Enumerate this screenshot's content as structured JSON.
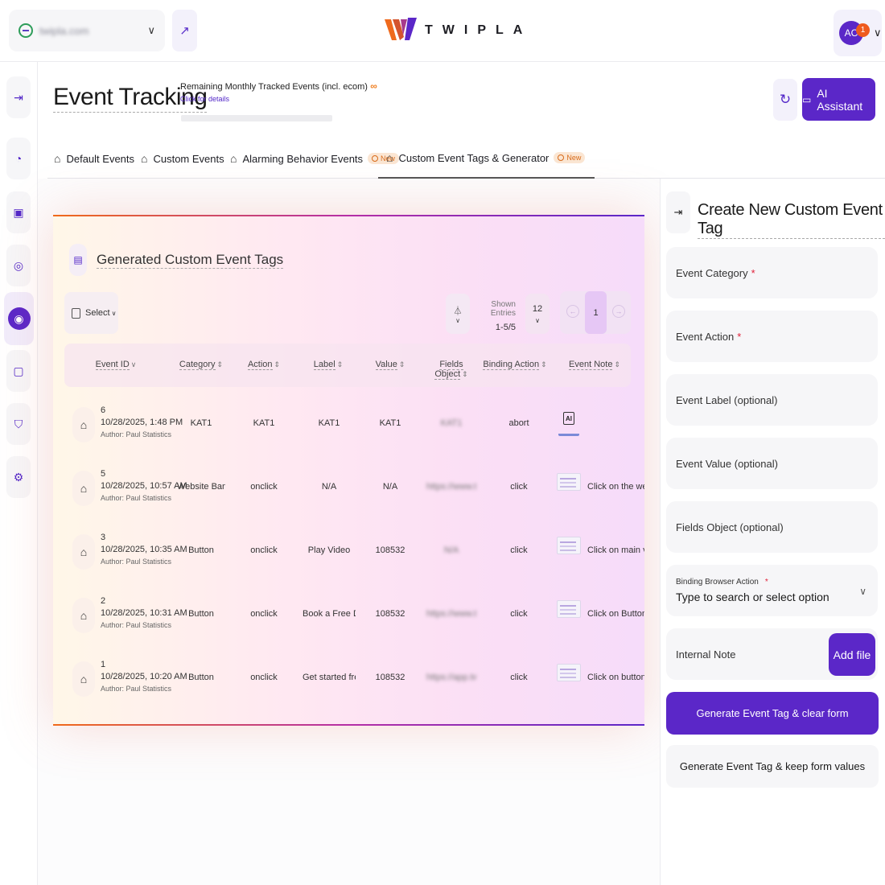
{
  "topbar": {
    "site": "twipla.com",
    "brand": "TWIPLA",
    "user_initials": "AC",
    "notification_count": "1"
  },
  "header": {
    "title": "Event Tracking",
    "quota_label": "Remaining Monthly Tracked Events (incl. ecom)",
    "quota_value": "∞",
    "quota_link": "Click for details",
    "ai_label": "AI Assistant"
  },
  "tabs": [
    {
      "label": "Default Events",
      "badge": ""
    },
    {
      "label": "Custom Events",
      "badge": ""
    },
    {
      "label": "Alarming Behavior Events",
      "badge": "New"
    },
    {
      "label": "Custom Event Tags & Generator",
      "badge": "New",
      "active": true
    }
  ],
  "table": {
    "title": "Generated Custom Event Tags",
    "select_label": "Select",
    "entries_label": "Shown Entries",
    "entries_range": "1-5/5",
    "per_page": "12",
    "page": "1",
    "columns": [
      "Event ID",
      "Category",
      "Action",
      "Label",
      "Value",
      "Fields Object",
      "Binding Action",
      "Event Note"
    ],
    "rows": [
      {
        "id": "6",
        "date": "10/28/2025, 1:48 PM",
        "author": "Author: Paul Statistics",
        "category": "KAT1",
        "action": "KAT1",
        "label": "KAT1",
        "value": "KAT1",
        "fields": "KAT1",
        "binding": "abort",
        "note": "",
        "note_type": "ai"
      },
      {
        "id": "5",
        "date": "10/28/2025, 10:57 AM",
        "author": "Author: Paul Statistics",
        "category": "Website Banner",
        "action": "onclick",
        "label": "N/A",
        "value": "N/A",
        "fields": "https://www.tw...",
        "binding": "click",
        "note": "Click on the we",
        "note_type": "thumb"
      },
      {
        "id": "3",
        "date": "10/28/2025, 10:35 AM",
        "author": "Author: Paul Statistics",
        "category": "Button",
        "action": "onclick",
        "label": "Play Video",
        "value": "108532",
        "fields": "N/A",
        "binding": "click",
        "note": "Click on main vi",
        "note_type": "thumb"
      },
      {
        "id": "2",
        "date": "10/28/2025, 10:31 AM",
        "author": "Author: Paul Statistics",
        "category": "Button",
        "action": "onclick",
        "label": "Book a Free De...",
        "value": "108532",
        "fields": "https://www.tw...",
        "binding": "click",
        "note": "Click on Button",
        "note_type": "thumb"
      },
      {
        "id": "1",
        "date": "10/28/2025, 10:20 AM",
        "author": "Author: Paul Statistics",
        "category": "Button",
        "action": "onclick",
        "label": "Get started free",
        "value": "108532",
        "fields": "https://app.tw...",
        "binding": "click",
        "note": "Click on button",
        "note_type": "thumb"
      }
    ]
  },
  "form": {
    "title": "Create New Custom Event Tag",
    "event_category": "Event Category",
    "event_action": "Event Action",
    "event_label": "Event Label (optional)",
    "event_value": "Event Value (optional)",
    "fields_object": "Fields Object (optional)",
    "binding_label": "Binding Browser Action",
    "binding_placeholder": "Type to search or select option",
    "internal_note": "Internal Note",
    "add_file": "Add file",
    "generate_clear": "Generate Event Tag & clear form",
    "generate_keep": "Generate Event Tag & keep form values",
    "required_mark": "*"
  },
  "colors": {
    "accent": "#5b27c8",
    "orange": "#ef5a1d"
  }
}
